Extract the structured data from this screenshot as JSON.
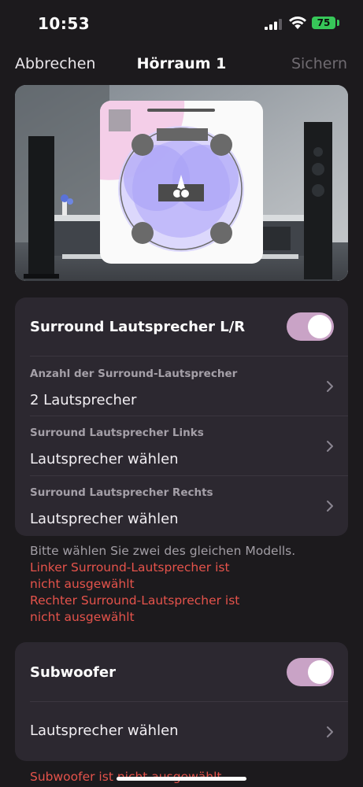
{
  "status_bar": {
    "time": "10:53",
    "battery": "75"
  },
  "nav": {
    "cancel_label": "Abbrechen",
    "title": "Hörraum 1",
    "save_label": "Sichern"
  },
  "surround": {
    "title": "Surround Lautsprecher L/R",
    "enabled": true,
    "rows": [
      {
        "label": "Anzahl der Surround-Lautsprecher",
        "value": "2 Lautsprecher"
      },
      {
        "label": "Surround Lautsprecher Links",
        "value": "Lautsprecher wählen"
      },
      {
        "label": "Surround Lautsprecher Rechts",
        "value": "Lautsprecher wählen"
      }
    ],
    "hint": "Bitte wählen Sie zwei des gleichen Modells.",
    "errors": [
      "Linker Surround-Lautsprecher ist",
      "nicht ausgewählt",
      "Rechter Surround-Lautsprecher ist",
      "nicht ausgewählt"
    ]
  },
  "subwoofer": {
    "title": "Subwoofer",
    "enabled": true,
    "value": "Lautsprecher wählen",
    "error": "Subwoofer ist nicht ausgewählt"
  },
  "colors": {
    "background": "#1c1a1d",
    "card": "#2c2830",
    "toggle_on": "#c9a3c6",
    "error": "#e5534b",
    "battery": "#37c759"
  }
}
